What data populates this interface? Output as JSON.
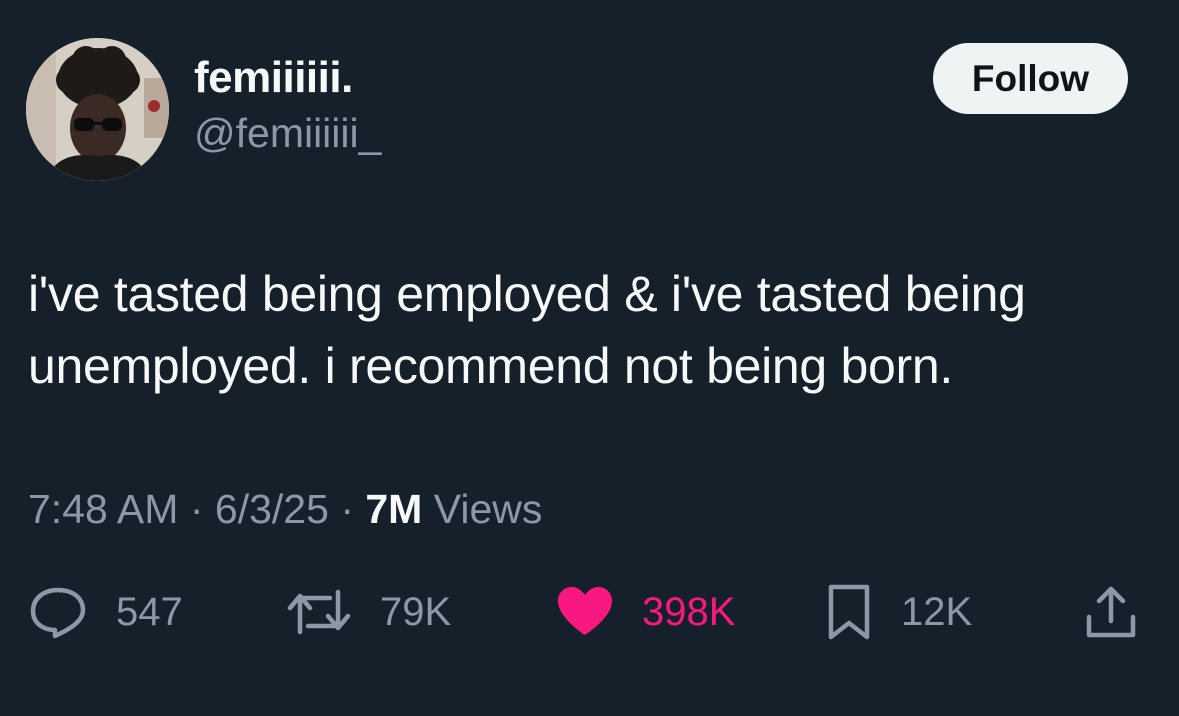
{
  "author": {
    "display_name": "femiiiiii.",
    "handle": "@femiiiiii_"
  },
  "follow_label": "Follow",
  "tweet": {
    "line1": "i've tasted being employed & i've tasted being",
    "line2": "unemployed. i recommend not being born."
  },
  "meta": {
    "time": "7:48 AM",
    "sep1": "·",
    "date": "6/3/25",
    "sep2": "·",
    "views_count": "7M",
    "views_label": "Views"
  },
  "actions": {
    "replies": "547",
    "reposts": "79K",
    "likes": "398K",
    "bookmarks": "12K"
  },
  "colors": {
    "background": "#15202b",
    "text": "#f7f9f9",
    "secondary": "#8b98a5",
    "like": "#f91880",
    "follow_bg": "#eff3f4"
  },
  "icons": [
    "reply-icon",
    "repost-icon",
    "heart-icon",
    "bookmark-icon",
    "share-icon"
  ]
}
